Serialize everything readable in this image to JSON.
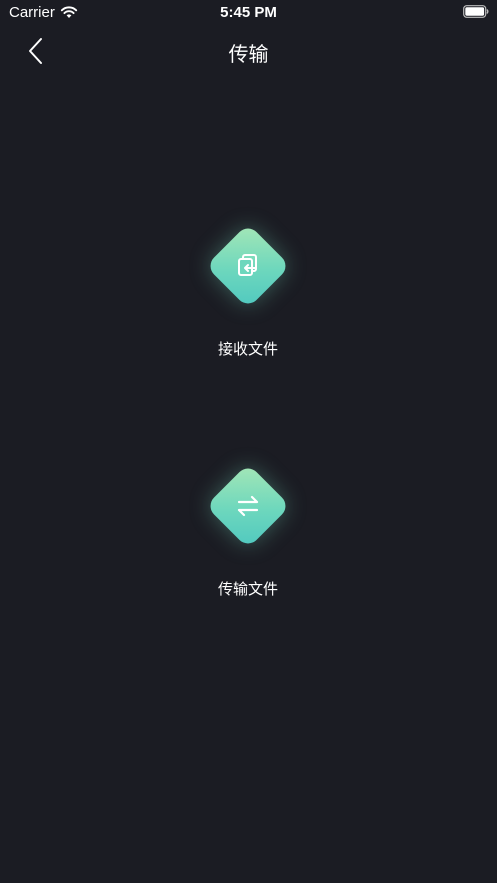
{
  "status_bar": {
    "carrier": "Carrier",
    "time": "5:45 PM"
  },
  "nav": {
    "title": "传输"
  },
  "actions": [
    {
      "label": "接收文件",
      "icon": "receive-file-icon"
    },
    {
      "label": "传输文件",
      "icon": "transfer-arrows-icon"
    }
  ],
  "colors": {
    "background": "#1b1c23",
    "accent_start": "#a6e7b6",
    "accent_end": "#4fc8c0",
    "text": "#ffffff"
  }
}
